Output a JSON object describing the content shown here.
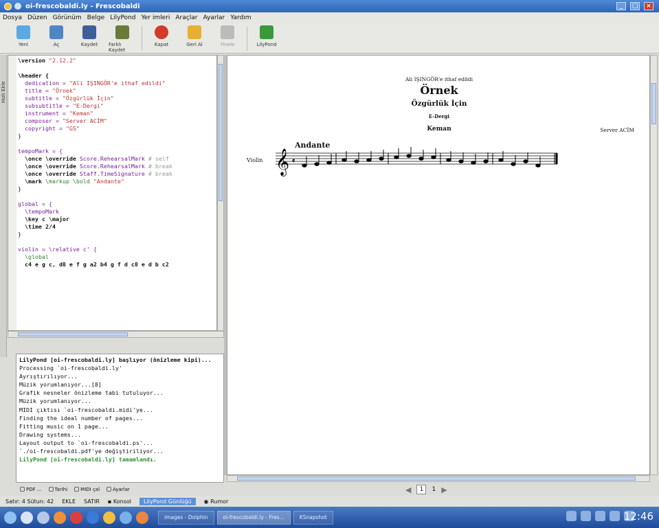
{
  "window": {
    "title": "oi-frescobaldi.ly - Frescobaldi"
  },
  "menu": [
    "Dosya",
    "Düzen",
    "Görünüm",
    "Belge",
    "LilyPond",
    "Yer imleri",
    "Araçlar",
    "Ayarlar",
    "Yardım"
  ],
  "toolbar": [
    {
      "label": "Yeni",
      "icon": "new-document-icon",
      "color": "#5aa9e6"
    },
    {
      "label": "Aç",
      "icon": "open-folder-icon",
      "color": "#4f86c6"
    },
    {
      "label": "Kaydet",
      "icon": "save-icon",
      "color": "#3d5f9a"
    },
    {
      "label": "Farklı Kaydet",
      "icon": "save-as-icon",
      "color": "#6a7a3a"
    },
    {
      "label": "Kapat",
      "icon": "close-document-icon",
      "color": "#d23a2a"
    },
    {
      "label": "Geri Al",
      "icon": "undo-icon",
      "color": "#e8b030"
    },
    {
      "label": "Yinele",
      "icon": "redo-icon",
      "color": "#bbbbbb",
      "disabled": true
    },
    {
      "label": "LilyPond",
      "icon": "lilypond-icon",
      "color": "#3a9a3a"
    }
  ],
  "sidetab": "Hızlı Ekle",
  "editor": {
    "lines": [
      [
        {
          "t": "\\version ",
          "c": "kw"
        },
        {
          "t": "\"2.12.2\"",
          "c": "str"
        }
      ],
      [
        {
          "t": ""
        }
      ],
      [
        {
          "t": "\\header {",
          "c": "kw"
        }
      ],
      [
        {
          "t": "  dedication = ",
          "c": "var"
        },
        {
          "t": "\"Ali IŞINGÖR'e ithaf edildi\"",
          "c": "str"
        }
      ],
      [
        {
          "t": "  title = ",
          "c": "var"
        },
        {
          "t": "\"Örnek\"",
          "c": "str"
        }
      ],
      [
        {
          "t": "  subtitle = ",
          "c": "var"
        },
        {
          "t": "\"Özgürlük İçin\"",
          "c": "str"
        }
      ],
      [
        {
          "t": "  subsubtitle = ",
          "c": "var"
        },
        {
          "t": "\"E-Dergi\"",
          "c": "str"
        }
      ],
      [
        {
          "t": "  instrument = ",
          "c": "var"
        },
        {
          "t": "\"Keman\"",
          "c": "str"
        }
      ],
      [
        {
          "t": "  composer = ",
          "c": "var"
        },
        {
          "t": "\"Server ACİM\"",
          "c": "str"
        }
      ],
      [
        {
          "t": "  copyright = ",
          "c": "var"
        },
        {
          "t": "\"GS\"",
          "c": "str"
        }
      ],
      [
        {
          "t": "}"
        }
      ],
      [
        {
          "t": ""
        }
      ],
      [
        {
          "t": "tempoMark = {",
          "c": "var"
        }
      ],
      [
        {
          "t": "  \\once \\override ",
          "c": "kw"
        },
        {
          "t": "Score",
          "c": "var"
        },
        {
          "t": ".RehearsalMark ",
          "c": "var"
        },
        {
          "t": "# self",
          "c": "cm"
        }
      ],
      [
        {
          "t": "  \\once \\override ",
          "c": "kw"
        },
        {
          "t": "Score",
          "c": "var"
        },
        {
          "t": ".RehearsalMark ",
          "c": "var"
        },
        {
          "t": "# break",
          "c": "cm"
        }
      ],
      [
        {
          "t": "  \\once \\override ",
          "c": "kw"
        },
        {
          "t": "Staff",
          "c": "var"
        },
        {
          "t": ".TimeSignature ",
          "c": "var"
        },
        {
          "t": "# break",
          "c": "cm"
        }
      ],
      [
        {
          "t": "  \\mark ",
          "c": "kw"
        },
        {
          "t": "\\markup \\bold ",
          "c": "grn"
        },
        {
          "t": "\"Andante\"",
          "c": "str"
        }
      ],
      [
        {
          "t": "}"
        }
      ],
      [
        {
          "t": ""
        }
      ],
      [
        {
          "t": "global = {",
          "c": "var"
        }
      ],
      [
        {
          "t": "  \\tempoMark",
          "c": "var"
        }
      ],
      [
        {
          "t": "  \\key c \\major",
          "c": "kw"
        }
      ],
      [
        {
          "t": "  \\time 2/4",
          "c": "kw"
        }
      ],
      [
        {
          "t": "}"
        }
      ],
      [
        {
          "t": ""
        }
      ],
      [
        {
          "t": "violin = \\relative c' {",
          "c": "var"
        }
      ],
      [
        {
          "t": "  \\global",
          "c": "grn"
        }
      ],
      [
        {
          "t": "  c4 e g c, d8 e f g a2 b4 g f d c8 e d b c2",
          "c": "kw"
        }
      ]
    ]
  },
  "log": {
    "lines": [
      {
        "t": "LilyPond [oi-frescobaldi.ly] başlıyor (önizleme kipi)...",
        "c": "hd"
      },
      {
        "t": "Processing `oi-frescobaldi.ly'"
      },
      {
        "t": "Ayrıştırılıyor..."
      },
      {
        "t": "Müzik yorumlanıyor...[8]"
      },
      {
        "t": "Grafik nesneler önizleme tabi tutuluyor..."
      },
      {
        "t": "Müzik yorumlanıyor..."
      },
      {
        "t": "MIDI çıktısı `oi-frescobaldi.midi'ye..."
      },
      {
        "t": "Finding the ideal number of pages..."
      },
      {
        "t": "Fitting music on 1 page..."
      },
      {
        "t": "Drawing systems..."
      },
      {
        "t": "Layout output to `oi-frescobaldi.ps'..."
      },
      {
        "t": "`./oi-frescobaldi.pdf'ye değiştiriliyor..."
      },
      {
        "t": "LilyPond [oi-frescobaldi.ly] tamamlandı.",
        "c": "ok"
      }
    ],
    "tabs": [
      "PDF ...",
      "Tarihi",
      "MIDI çal",
      "Ayarlar"
    ]
  },
  "score": {
    "dedication": "Ali IŞINGÖR'e ithaf edildi",
    "title": "Örnek",
    "subtitle": "Özgürlük İçin",
    "subsubtitle": "E-Dergi",
    "instrument": "Keman",
    "composer": "Server ACİM",
    "tempo": "Andante",
    "staff_label": "Violin"
  },
  "pagenav": {
    "page": "1",
    "total": "1"
  },
  "status": {
    "position": "Satır: 4 Sütun: 42",
    "mode": "EKLE",
    "selection": "SATIR",
    "console": "Konsol",
    "lilypond": "LilyPond Günlüğü",
    "rumor": "Rumor"
  },
  "taskbar": {
    "tasks": [
      {
        "label": "images - Dolphin",
        "active": false
      },
      {
        "label": "oi-frescobaldi.ly - Fres...",
        "active": true
      },
      {
        "label": "KSnapshot",
        "active": false
      }
    ],
    "clock": "12:46"
  }
}
